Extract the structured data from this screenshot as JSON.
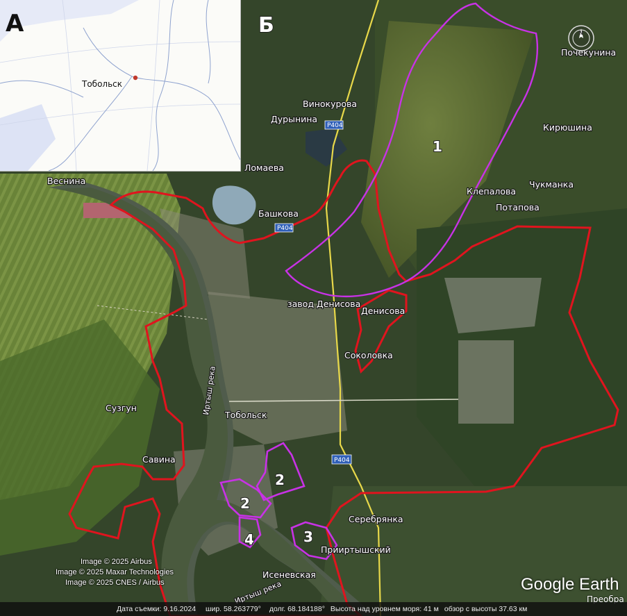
{
  "panels": {
    "a": "А",
    "b": "Б"
  },
  "inset": {
    "city": "Тобольск",
    "city_marker_color": "#c0392b"
  },
  "zones": [
    "1",
    "2",
    "2",
    "3",
    "4"
  ],
  "places": {
    "pochekunina": "Почекунина",
    "vinokurova": "Винокурова",
    "durynina": "Дурынина",
    "kiryushina": "Кирюшина",
    "lomaeva": "Ломаева",
    "vesnina": "Веснина",
    "klepalova": "Клепалова",
    "chukmanka": "Чукманка",
    "potapova": "Потапова",
    "bashkova": "Башкова",
    "zavod_denisova": "завод Денисова",
    "denisova": "Денисова",
    "sokolovka": "Соколовка",
    "suzgun": "Сузгун",
    "tobolsk": "Тобольск",
    "savina": "Савина",
    "serebryanka": "Серебрянка",
    "priirtyshsky": "Прииртышский",
    "isenevskaya": "Исеневская",
    "preobr": "Преобра"
  },
  "rivers": {
    "irtysh": "Иртыш река",
    "irtysh2": "Иртыш река"
  },
  "roads": [
    "Р404",
    "Р404",
    "Р404"
  ],
  "credits": [
    "Image © 2025 Airbus",
    "Image © 2025 Maxar Technologies",
    "Image © 2025 CNES / Airbus"
  ],
  "logo": "Google Earth",
  "compass_north": "N",
  "status": {
    "date": "Дата съемки: 9.16.2024",
    "lat": "шир.   58.263779°",
    "lon": "долг.   68.184188°",
    "elev": "Высота над уровнем моря:   41 м",
    "eye": "обзор с высоты   37.63 км"
  },
  "colors": {
    "border_red": "#e0141e",
    "zone_purple": "#c832e6"
  }
}
